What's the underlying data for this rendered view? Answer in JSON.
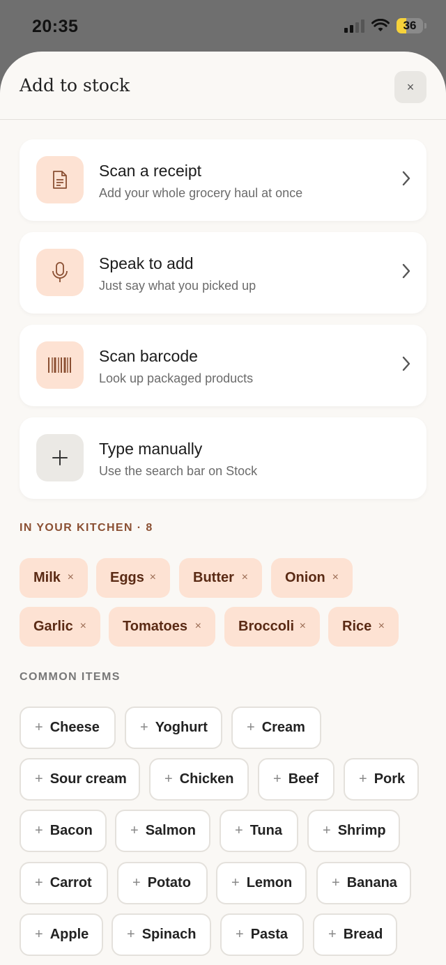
{
  "status": {
    "time": "20:35",
    "battery": "36",
    "battery_level_percent": 36
  },
  "sheet": {
    "title": "Add to stock",
    "close_label": "×"
  },
  "options": [
    {
      "title": "Scan a receipt",
      "subtitle": "Add your whole grocery haul at once",
      "icon": "receipt-icon"
    },
    {
      "title": "Speak to add",
      "subtitle": "Just say what you picked up",
      "icon": "microphone-icon"
    },
    {
      "title": "Scan barcode",
      "subtitle": "Look up packaged products",
      "icon": "barcode-icon"
    },
    {
      "title": "Type manually",
      "subtitle": "Use the search bar on Stock",
      "icon": "plus-icon"
    }
  ],
  "kitchen": {
    "label": "IN YOUR KITCHEN · 8",
    "items": [
      "Milk",
      "Eggs",
      "Butter",
      "Onion",
      "Garlic",
      "Tomatoes",
      "Broccoli",
      "Rice"
    ],
    "remove_glyph": "×"
  },
  "common": {
    "label": "COMMON ITEMS",
    "items": [
      "Cheese",
      "Yoghurt",
      "Cream",
      "Sour cream",
      "Chicken",
      "Beef",
      "Pork",
      "Bacon",
      "Salmon",
      "Tuna",
      "Shrimp",
      "Carrot",
      "Potato",
      "Lemon",
      "Banana",
      "Apple",
      "Spinach",
      "Pasta",
      "Bread"
    ],
    "add_glyph": "+"
  },
  "colors": {
    "accent": "#fde2d3",
    "accent_text": "#5a2a14",
    "section_accent": "#8a4f32",
    "sheet_bg": "#faf8f5"
  }
}
